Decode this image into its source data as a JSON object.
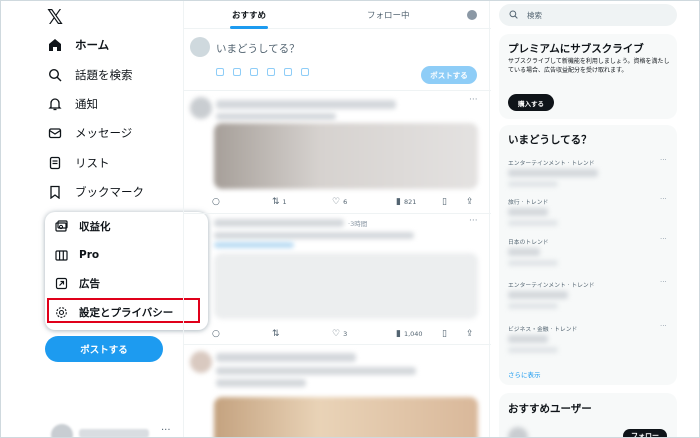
{
  "logo": "𝕏",
  "nav": {
    "items": [
      {
        "label": "ホーム",
        "icon": "home-icon"
      },
      {
        "label": "話題を検索",
        "icon": "search-icon"
      },
      {
        "label": "通知",
        "icon": "bell-icon"
      },
      {
        "label": "メッセージ",
        "icon": "mail-icon"
      },
      {
        "label": "リスト",
        "icon": "list-icon"
      },
      {
        "label": "ブックマーク",
        "icon": "bookmark-icon"
      }
    ],
    "post_button": "ポストする"
  },
  "more_menu": {
    "items": [
      {
        "label": "収益化",
        "icon": "monetization-icon"
      },
      {
        "label": "Pro",
        "icon": "columns-icon"
      },
      {
        "label": "広告",
        "icon": "ads-arrow-icon"
      },
      {
        "label": "設定とプライバシー",
        "icon": "gear-icon"
      }
    ]
  },
  "timeline": {
    "tabs": [
      {
        "label": "おすすめ",
        "active": true
      },
      {
        "label": "フォロー中",
        "active": false
      }
    ],
    "composer": {
      "placeholder": "いまどうしてる？",
      "post_button": "ポストする"
    },
    "posts": [
      {
        "time": "",
        "replies": "",
        "reposts": "1",
        "likes": "6",
        "views": "821"
      },
      {
        "time": "·3時間",
        "replies": "",
        "reposts": "",
        "likes": "3",
        "views": "1,040"
      }
    ]
  },
  "sidebar": {
    "search_placeholder": "検索",
    "premium": {
      "title": "プレミアムにサブスクライブ",
      "description": "サブスクライブして新機能を利用しましょう。資格を満たしている場合、広告収益配分を受け取れます。",
      "button": "購入する"
    },
    "trends": {
      "title": "いまどうしてる？",
      "items": [
        {
          "category": "エンターテインメント · トレンド"
        },
        {
          "category": "旅行 · トレンド"
        },
        {
          "category": "日本のトレンド"
        },
        {
          "category": "エンターテインメント · トレンド"
        },
        {
          "category": "ビジネス・金融 · トレンド"
        }
      ],
      "show_more": "さらに表示"
    },
    "who_to_follow": {
      "title": "おすすめユーザー",
      "follow_button": "フォロー"
    }
  },
  "colors": {
    "accent": "#1d9bf0",
    "highlight_box": "#e0001a",
    "text": "#0f1419",
    "muted": "#536471"
  }
}
